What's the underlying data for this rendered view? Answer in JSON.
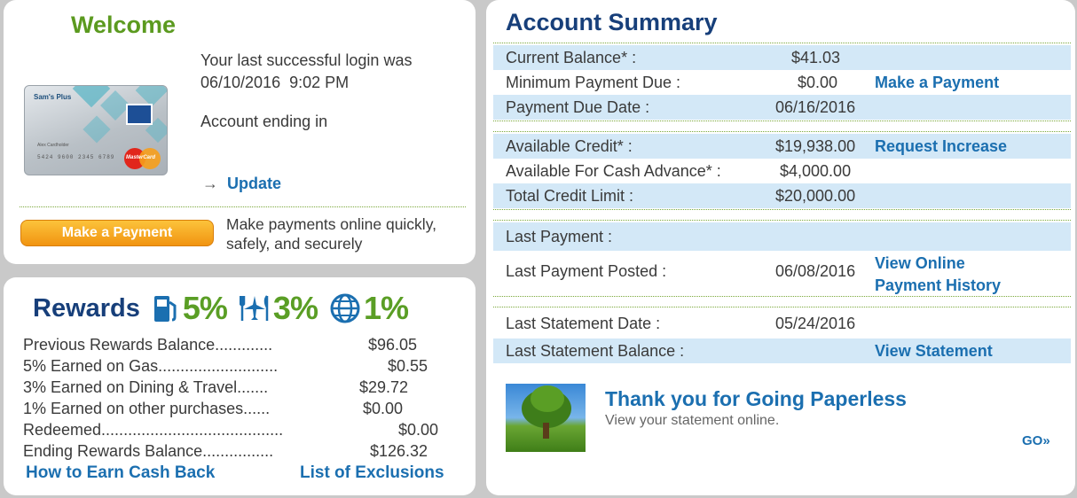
{
  "welcome": {
    "title": "Welcome",
    "card_brand": "Sam's Plus",
    "card_name": "Alex Cardholder",
    "card_number": "5424 9600 2345 6789",
    "card_network": "MasterCard",
    "login_line1": "Your last successful login was",
    "login_line2": "06/10/2016  9:02 PM",
    "account_ending": "Account ending in",
    "update_arrow": "→",
    "update_label": "Update",
    "make_payment_label": "Make a Payment",
    "payment_text_line1": "Make payments online quickly,",
    "payment_text_line2": "safely, and securely"
  },
  "rewards": {
    "title": "Rewards",
    "gas_pct": "5%",
    "travel_pct": "3%",
    "other_pct": "1%",
    "rows": [
      {
        "label": "Previous Rewards Balance.............",
        "value": "$96.05"
      },
      {
        "label": "5% Earned on Gas...........................",
        "value": "$0.55"
      },
      {
        "label": "3% Earned on Dining & Travel.......",
        "value": "$29.72"
      },
      {
        "label": "1% Earned on other purchases......",
        "value": "$0.00"
      },
      {
        "label": "Redeemed.........................................",
        "value": "$0.00"
      },
      {
        "label": "Ending Rewards Balance................",
        "value": "$126.32"
      }
    ],
    "link_earn": "How to Earn Cash Back",
    "link_exclusions": "List of Exclusions"
  },
  "summary": {
    "title": "Account Summary",
    "rows": [
      {
        "label": "Current Balance* :",
        "value": "$41.03",
        "link": ""
      },
      {
        "label": "Minimum Payment Due :",
        "value": "$0.00",
        "link": "Make a Payment"
      },
      {
        "label": "Payment Due Date :",
        "value": "06/16/2016",
        "link": ""
      },
      {
        "label": "Available Credit* :",
        "value": "$19,938.00",
        "link": "Request Increase"
      },
      {
        "label": "Available For Cash Advance* :",
        "value": "$4,000.00",
        "link": ""
      },
      {
        "label": "Total Credit Limit :",
        "value": "$20,000.00",
        "link": ""
      },
      {
        "label": "Last Payment :",
        "value": "",
        "link": ""
      },
      {
        "label": "Last Payment Posted :",
        "value": "06/08/2016",
        "link": "View Online",
        "link2": "Payment History"
      },
      {
        "label": "Last Statement Date :",
        "value": "05/24/2016",
        "link": ""
      },
      {
        "label": "Last Statement Balance :",
        "value": "",
        "link": "View Statement"
      }
    ],
    "promo_title": "Thank you for Going Paperless",
    "promo_sub": "View your statement online.",
    "promo_go": "GO»"
  },
  "colors": {
    "green": "#5b9a1f",
    "navy": "#173f7a",
    "link_blue": "#1b6fb0",
    "row_blue": "#d3e8f7",
    "orange": "#f19411"
  }
}
